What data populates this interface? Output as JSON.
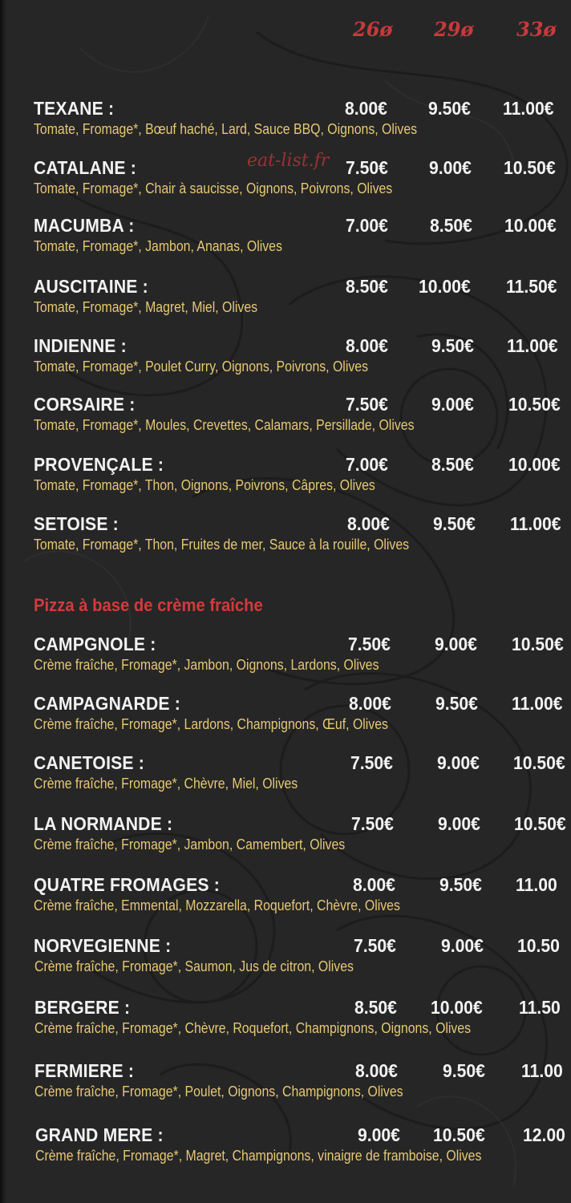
{
  "sizes": [
    "26ø",
    "29ø",
    "33ø"
  ],
  "watermark": "eat-list.fr",
  "tomato_pizzas": [
    {
      "name": "TEXANE :",
      "desc": "Tomate, Fromage*, Bœuf haché, Lard, Sauce BBQ, Oignons, Olives",
      "prices": [
        "8.00€",
        "9.50€",
        "11.00€"
      ]
    },
    {
      "name": "CATALANE :",
      "desc": "Tomate, Fromage*, Chair à saucisse, Oignons, Poivrons, Olives",
      "prices": [
        "7.50€",
        "9.00€",
        "10.50€"
      ]
    },
    {
      "name": "MACUMBA :",
      "desc": "Tomate, Fromage*, Jambon, Ananas, Olives",
      "prices": [
        "7.00€",
        "8.50€",
        "10.00€"
      ]
    },
    {
      "name": "AUSCITAINE :",
      "desc": "Tomate, Fromage*, Magret, Miel, Olives",
      "prices": [
        "8.50€",
        "10.00€",
        "11.50€"
      ]
    },
    {
      "name": "INDIENNE :",
      "desc": "Tomate, Fromage*, Poulet Curry, Oignons, Poivrons, Olives",
      "prices": [
        "8.00€",
        "9.50€",
        "11.00€"
      ]
    },
    {
      "name": "CORSAIRE :",
      "desc": "Tomate, Fromage*, Moules, Crevettes, Calamars, Persillade, Olives",
      "prices": [
        "7.50€",
        "9.00€",
        "10.50€"
      ]
    },
    {
      "name": "PROVENÇALE :",
      "desc": "Tomate, Fromage*, Thon, Oignons, Poivrons, Câpres, Olives",
      "prices": [
        "7.00€",
        "8.50€",
        "10.00€"
      ]
    },
    {
      "name": "SETOISE :",
      "desc": "Tomate, Fromage*, Thon, Fruites de mer, Sauce à la rouille, Olives",
      "prices": [
        "8.00€",
        "9.50€",
        "11.00€"
      ]
    }
  ],
  "cream_section_title": "Pizza à base de crème fraîche",
  "cream_pizzas": [
    {
      "name": "CAMPGNOLE :",
      "desc": "Crème fraîche, Fromage*, Jambon, Oignons, Lardons, Olives",
      "prices": [
        "7.50€",
        "9.00€",
        "10.50€"
      ]
    },
    {
      "name": "CAMPAGNARDE :",
      "desc": "Crème fraîche, Fromage*, Lardons, Champignons, Œuf, Olives",
      "prices": [
        "8.00€",
        "9.50€",
        "11.00€"
      ]
    },
    {
      "name": "CANETOISE :",
      "desc": "Crème fraîche, Fromage*, Chèvre, Miel, Olives",
      "prices": [
        "7.50€",
        "9.00€",
        "10.50€"
      ]
    },
    {
      "name": "LA NORMANDE :",
      "desc": "Crème fraîche, Fromage*, Jambon, Camembert, Olives",
      "prices": [
        "7.50€",
        "9.00€",
        "10.50€"
      ]
    },
    {
      "name": "QUATRE FROMAGES :",
      "desc": "Crème fraîche, Emmental, Mozzarella, Roquefort, Chèvre, Olives",
      "prices": [
        "8.00€",
        "9.50€",
        "11.00"
      ]
    },
    {
      "name": "NORVEGIENNE :",
      "desc": "Crème fraîche, Fromage*, Saumon, Jus de citron, Olives",
      "prices": [
        "7.50€",
        "9.00€",
        "10.50"
      ]
    },
    {
      "name": "BERGERE :",
      "desc": "Crème fraîche, Fromage*, Chèvre, Roquefort, Champignons, Oignons, Olives",
      "prices": [
        "8.50€",
        "10.00€",
        "11.50"
      ]
    },
    {
      "name": "FERMIERE :",
      "desc": "Crème fraîche, Fromage*, Poulet, Oignons, Champignons, Olives",
      "prices": [
        "8.00€",
        "9.50€",
        "11.00"
      ]
    },
    {
      "name": "GRAND MERE :",
      "desc": "Crème fraîche, Fromage*, Magret, Champignons, vinaigre de framboise, Olives",
      "prices": [
        "9.00€",
        "10.50€",
        "12.00"
      ]
    }
  ]
}
